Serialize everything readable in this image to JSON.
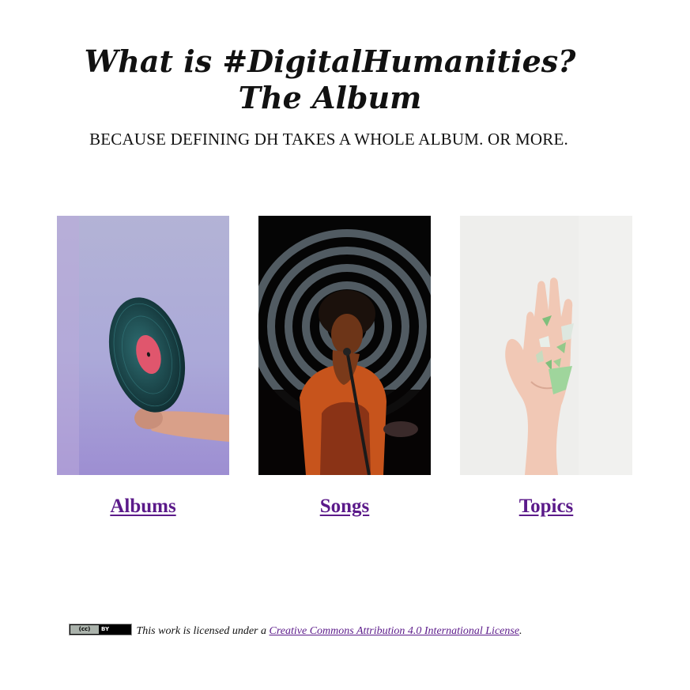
{
  "header": {
    "title_line1": "What is #DigitalHumanities?",
    "title_line2": "The Album",
    "tagline": "BECAUSE DEFINING DH TAKES A WHOLE ALBUM. OR MORE."
  },
  "tiles": [
    {
      "label": "Albums",
      "image": "vinyl-record-photo"
    },
    {
      "label": "Songs",
      "image": "singer-with-microphone-photo"
    },
    {
      "label": "Topics",
      "image": "hand-holding-sea-glass-photo"
    }
  ],
  "footer": {
    "badge_left": "(cc)",
    "badge_right": "BY",
    "text": "This work is licensed under a",
    "link_text": "Creative Commons Attribution 4.0 International License",
    "end": "."
  },
  "colors": {
    "link": "#5b1a8a",
    "background": "#ffffff",
    "text": "#111111"
  }
}
